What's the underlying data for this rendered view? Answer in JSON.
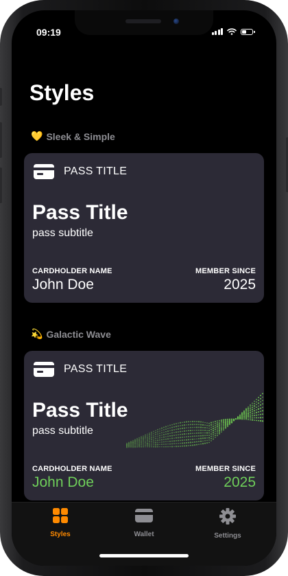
{
  "status_bar": {
    "time": "09:19",
    "battery_level": 0.4
  },
  "page": {
    "title": "Styles"
  },
  "sections": [
    {
      "emoji": "💛",
      "name": "Sleek & Simple",
      "card": {
        "header_label": "PASS TITLE",
        "title": "Pass Title",
        "subtitle": "pass subtitle",
        "field_left_label": "CARDHOLDER NAME",
        "field_left_value": "John Doe",
        "field_right_label": "MEMBER SINCE",
        "field_right_value": "2025",
        "value_color": "#ffffff"
      }
    },
    {
      "emoji": "💫",
      "name": "Galactic Wave",
      "card": {
        "header_label": "PASS TITLE",
        "title": "Pass Title",
        "subtitle": "pass subtitle",
        "field_left_label": "CARDHOLDER NAME",
        "field_left_value": "John Doe",
        "field_right_label": "MEMBER SINCE",
        "field_right_value": "2025",
        "value_color": "#6fcf5a"
      }
    }
  ],
  "tabbar": {
    "active_color": "#ff8a00",
    "inactive_color": "#8e8e93",
    "tabs": [
      {
        "label": "Styles",
        "icon": "grid-icon",
        "active": true
      },
      {
        "label": "Wallet",
        "icon": "wallet-icon",
        "active": false
      },
      {
        "label": "Settings",
        "icon": "gear-icon",
        "active": false
      }
    ]
  }
}
